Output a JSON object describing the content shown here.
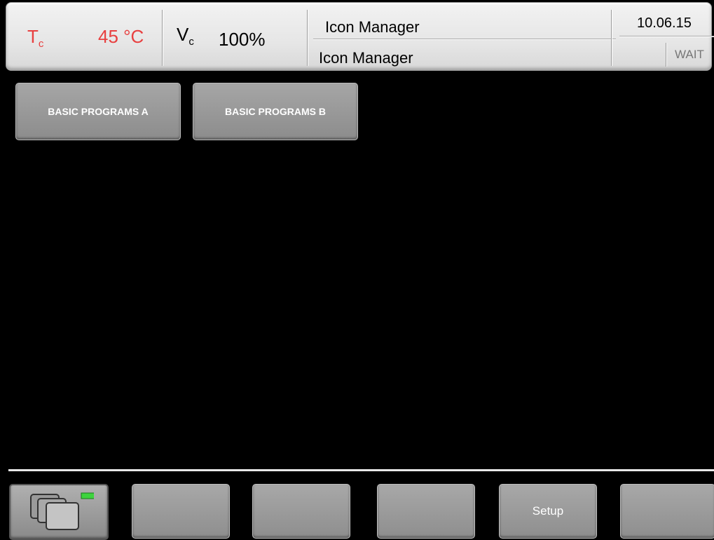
{
  "header": {
    "tc_label": "T",
    "tc_sub": "c",
    "tc_value": "45 °C",
    "vc_label": "V",
    "vc_sub": "c",
    "vc_value": "100%",
    "message_line1": "Icon Manager",
    "message_line2": "Icon Manager",
    "date": "10.06.15",
    "status": "WAIT"
  },
  "programs": [
    {
      "label": "BASIC PROGRAMS A"
    },
    {
      "label": "BASIC PROGRAMS B"
    }
  ],
  "softkeys": [
    {
      "icon": "windows-stack-icon",
      "label": ""
    },
    {
      "label": ""
    },
    {
      "label": ""
    },
    {
      "label": ""
    },
    {
      "label": "Setup"
    },
    {
      "label": ""
    }
  ],
  "colors": {
    "tc": "#e84040",
    "indicator": "#3ed43e"
  }
}
